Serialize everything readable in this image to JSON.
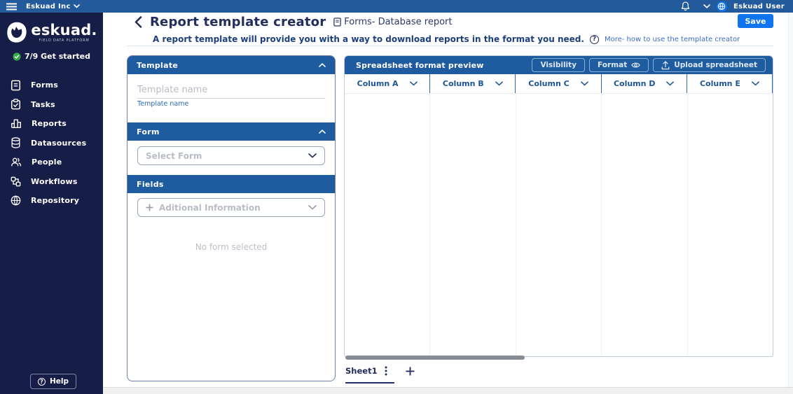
{
  "topbar": {
    "org_name": "Eskuad Inc",
    "user_name": "Eskuad User"
  },
  "sidebar": {
    "logo_text": "eskuad.",
    "logo_tagline": "Field Data Platform",
    "get_started": "7/9 Get started",
    "items": [
      {
        "label": "Forms",
        "icon": "form-icon"
      },
      {
        "label": "Tasks",
        "icon": "tasks-icon"
      },
      {
        "label": "Reports",
        "icon": "reports-icon"
      },
      {
        "label": "Datasources",
        "icon": "datasources-icon"
      },
      {
        "label": "People",
        "icon": "people-icon"
      },
      {
        "label": "Workflows",
        "icon": "workflows-icon"
      },
      {
        "label": "Repository",
        "icon": "repository-icon"
      }
    ],
    "help_label": "Help"
  },
  "header": {
    "title": "Report template creator",
    "context": "Forms- Database report",
    "subtitle": "A report template will provide you with a way to download reports in the format you need.",
    "more_link": "More- how to use the template creator",
    "save_label": "Save"
  },
  "template_panel": {
    "template_section_title": "Template",
    "template_name_placeholder": "Template name",
    "template_name_helper": "Template name",
    "form_section_title": "Form",
    "form_select_placeholder": "Select Form",
    "fields_section_title": "Fields",
    "fields_placeholder": "Aditional Information",
    "empty_state": "No form selected"
  },
  "spreadsheet": {
    "title": "Spreadsheet format preview",
    "buttons": {
      "visibility": "Visibility",
      "format": "Format",
      "upload": "Upload spreadsheet"
    },
    "columns": [
      "Column A",
      "Column B",
      "Column C",
      "Column D",
      "Column E"
    ],
    "sheet_tab": "Sheet1"
  },
  "colors": {
    "topbar": "#235a9b",
    "sidebar": "#161d47",
    "section_header": "#1f5c9f",
    "accent_blue": "#0f74ee",
    "column_text": "#1d5496",
    "success_green": "#35a947"
  }
}
